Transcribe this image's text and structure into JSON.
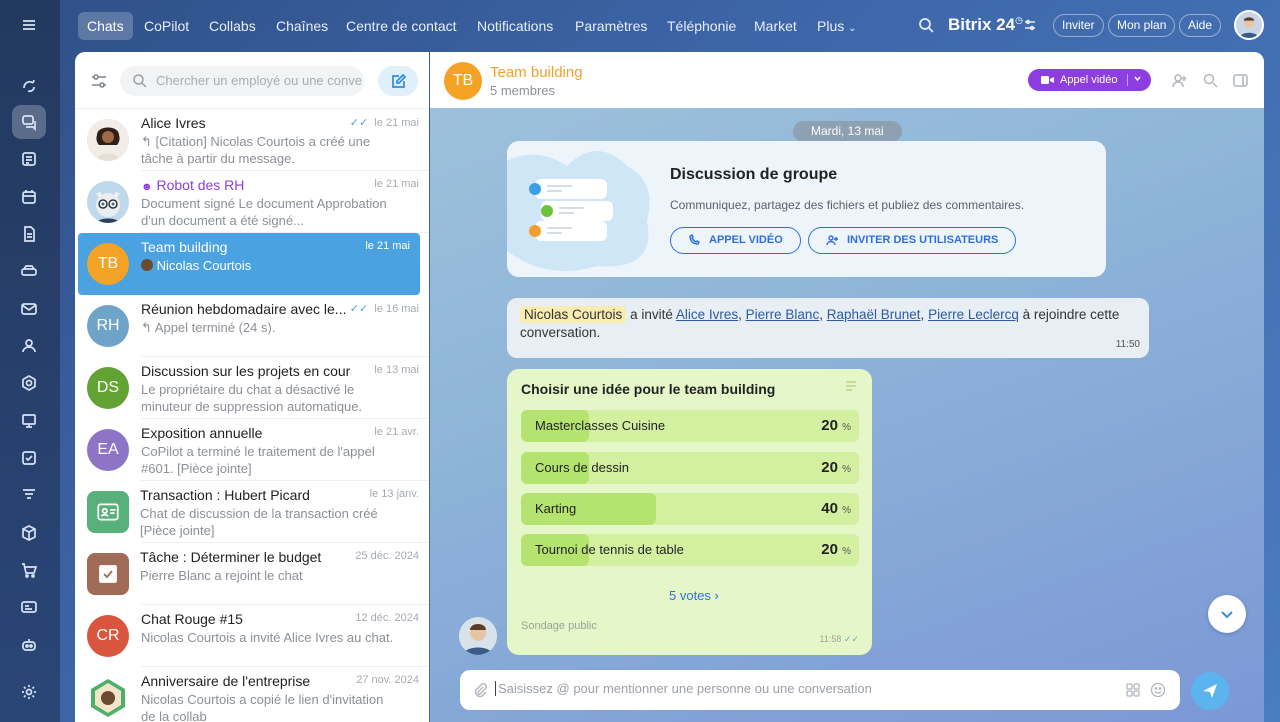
{
  "topnav": {
    "tabs": [
      "Chats",
      "CoPilot",
      "Collabs",
      "Chaînes",
      "Centre de contact",
      "Notifications",
      "Paramètres",
      "Téléphonie",
      "Market",
      "Plus"
    ],
    "brand": "Bitrix 24",
    "invite": "Inviter",
    "plan": "Mon plan",
    "help": "Aide"
  },
  "list": {
    "search_placeholder": "Chercher un employé ou une conve",
    "items": [
      {
        "name": "Alice Ivres",
        "date": "le 21 mai",
        "preview": "↰ [Citation] Nicolas Courtois a créé une tâche à partir du message."
      },
      {
        "name": "Robot des RH",
        "date": "le 21 mai",
        "preview": "Document signé Le document Approbation d'un document a été signé..."
      },
      {
        "name": "Team building",
        "date": "le 21 mai",
        "preview": "Nicolas Courtois",
        "initials": "TB"
      },
      {
        "name": "Réunion hebdomadaire avec le...",
        "date": "le 16 mai",
        "preview": "↰ Appel terminé (24 s).",
        "initials": "RH"
      },
      {
        "name": "Discussion sur les projets en cours",
        "date": "le 13 mai",
        "preview": "Le propriétaire du chat a désactivé le minuteur de suppression automatique.",
        "initials": "DS"
      },
      {
        "name": "Exposition annuelle",
        "date": "le 21 avr.",
        "preview": "CoPilot a terminé le traitement de l'appel #601. [Pièce jointe]",
        "initials": "EA"
      },
      {
        "name": "Transaction : Hubert Picard",
        "date": "le 13 janv.",
        "preview": "Chat de discussion de la transaction créé [Pièce jointe]"
      },
      {
        "name": "Tâche : Déterminer le budget",
        "date": "25 déc. 2024",
        "preview": "Pierre Blanc a rejoint le chat"
      },
      {
        "name": "Chat Rouge #15",
        "date": "12 déc. 2024",
        "preview": "Nicolas Courtois a invité Alice Ivres au chat.",
        "initials": "CR"
      },
      {
        "name": "Anniversaire de l'entreprise",
        "date": "27 nov. 2024",
        "preview": "Nicolas Courtois a copié le lien d'invitation de la collab"
      }
    ]
  },
  "chat": {
    "initials": "TB",
    "title": "Team building",
    "subtitle": "5 membres",
    "video_button": "Appel vidéo",
    "date_chip": "Mardi, 13 mai",
    "group_card": {
      "title": "Discussion de groupe",
      "desc": "Communiquez, partagez des fichiers et publiez des commentaires.",
      "btn_video": "APPEL VIDÉO",
      "btn_invite": "INVITER DES UTILISATEURS"
    },
    "system": {
      "actor": "Nicolas Courtois",
      "verb": "a invité",
      "users": [
        "Alice Ivres",
        "Pierre Blanc",
        "Raphaël Brunet",
        "Pierre Leclercq"
      ],
      "tail": "à rejoindre cette conversation.",
      "time": "11:50"
    },
    "poll": {
      "title": "Choisir une idée pour le team building",
      "options": [
        {
          "label": "Masterclasses Cuisine",
          "pct": 20
        },
        {
          "label": "Cours de dessin",
          "pct": 20
        },
        {
          "label": "Karting",
          "pct": 40
        },
        {
          "label": "Tournoi de tennis de table",
          "pct": 20
        }
      ],
      "pct_unit": "%",
      "votes": "5 votes",
      "footer": "Sondage public",
      "time": "11:58"
    },
    "composer_placeholder": "Saisissez @ pour mentionner une personne ou une conversation"
  },
  "colors": {
    "accent": "#8c3ee0",
    "active_item": "#4aa2e0",
    "poll_bg": "#e5f7c9",
    "poll_fill": "#b5e370"
  }
}
